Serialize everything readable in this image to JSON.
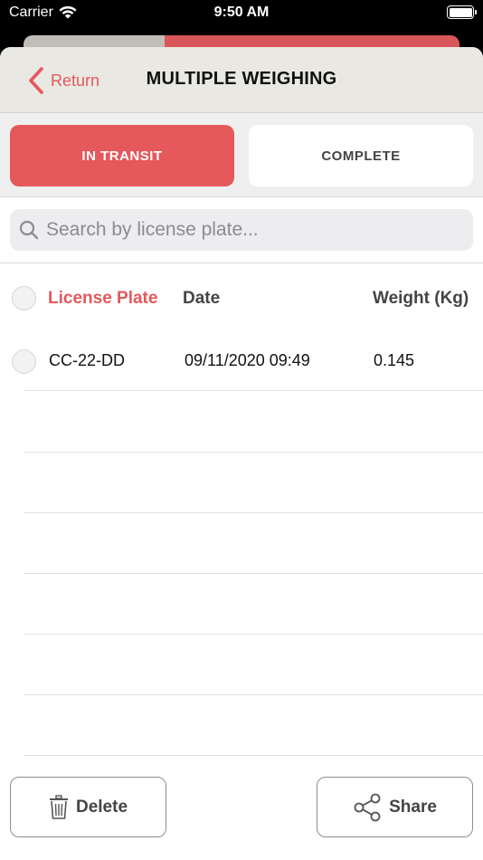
{
  "status_bar": {
    "carrier": "Carrier",
    "time": "9:50 AM"
  },
  "nav": {
    "back_label": "Return",
    "title": "MULTIPLE WEIGHING"
  },
  "segments": {
    "in_transit": "IN TRANSIT",
    "complete": "COMPLETE",
    "selected": "in_transit"
  },
  "search": {
    "placeholder": "Search by license plate...",
    "value": ""
  },
  "table": {
    "columns": {
      "plate": "License Plate",
      "date": "Date",
      "weight": "Weight (Kg)"
    },
    "rows": [
      {
        "plate": "CC-22-DD",
        "date": "09/11/2020 09:49",
        "weight": "0.145"
      }
    ]
  },
  "actions": {
    "delete_label": "Delete",
    "share_label": "Share"
  },
  "colors": {
    "accent": "#e5585b",
    "nav_bg": "#e9e8e3",
    "segment_bg": "#efefef"
  }
}
